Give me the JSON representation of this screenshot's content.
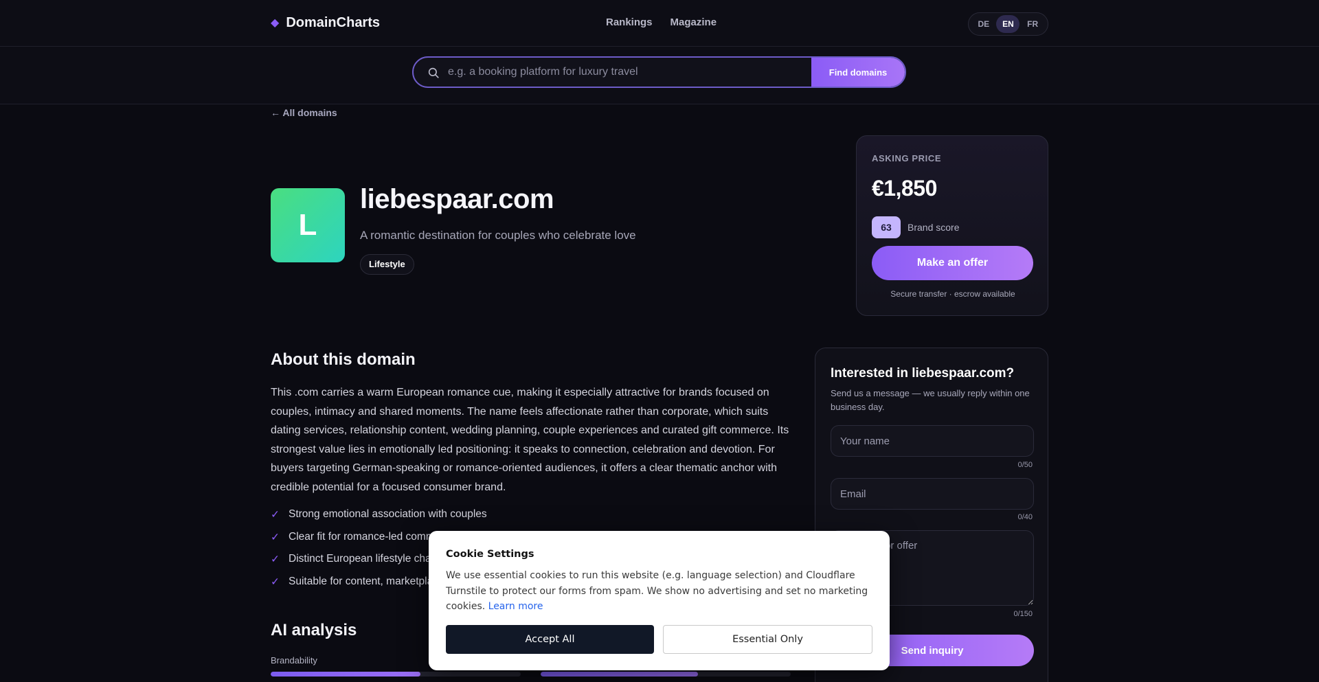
{
  "header": {
    "logo_text": "DomainCharts",
    "nav": [
      "Rankings",
      "Magazine"
    ],
    "languages": [
      "DE",
      "EN",
      "FR"
    ],
    "active_language": "EN"
  },
  "search": {
    "placeholder": "e.g. a booking platform for luxury travel",
    "button_label": "Find domains"
  },
  "back_link": "← All domains",
  "domain": {
    "initial": "L",
    "name": "liebespaar.com",
    "tagline": "A romantic destination for couples who celebrate love",
    "category": "Lifestyle"
  },
  "price_card": {
    "label": "ASKING PRICE",
    "price": "€1,850",
    "brand_score": "63",
    "brand_score_label": "Brand score",
    "offer_button": "Make an offer",
    "secure_note": "Secure transfer · escrow available"
  },
  "about": {
    "title": "About this domain",
    "text": "This .com carries a warm European romance cue, making it especially attractive for brands focused on couples, intimacy and shared moments. The name feels affectionate rather than corporate, which suits dating services, relationship content, wedding planning, couple experiences and curated gift commerce. Its strongest value lies in emotionally led positioning: it speaks to connection, celebration and devotion. For buyers targeting German-speaking or romance-oriented audiences, it offers a clear thematic anchor with credible potential for a focused consumer brand.",
    "features": [
      "Strong emotional association with couples",
      "Clear fit for romance-led comm",
      "Distinct European lifestyle char",
      "Suitable for content, marketpla"
    ]
  },
  "ai_analysis": {
    "title": "AI analysis",
    "metrics": [
      {
        "label": "Brandability",
        "fraction": 0.6
      },
      {
        "label": "",
        "fraction": 0.63
      }
    ]
  },
  "inquiry": {
    "title": "Interested in liebespaar.com?",
    "subtitle": "Send us a message — we usually reply within one business day.",
    "name_placeholder": "Your name",
    "name_counter": "0/50",
    "email_placeholder": "Email",
    "email_counter": "0/40",
    "message_placeholder": "Message or offer",
    "message_counter": "0/150",
    "send_button": "Send inquiry"
  },
  "cookie": {
    "title": "Cookie Settings",
    "text": "We use essential cookies to run this website (e.g. language selection) and Cloudflare Turnstile to protect our forms from spam. We show no advertising and set no marketing cookies.",
    "learn_more": "Learn more",
    "accept_label": "Accept All",
    "essential_label": "Essential Only"
  },
  "colors": {
    "accent": "#8b5cf6",
    "background": "#0b0b12",
    "avatar_gradient_start": "#4ade80",
    "avatar_gradient_end": "#2dd4bf",
    "score_badge": "#c4b5fd"
  }
}
